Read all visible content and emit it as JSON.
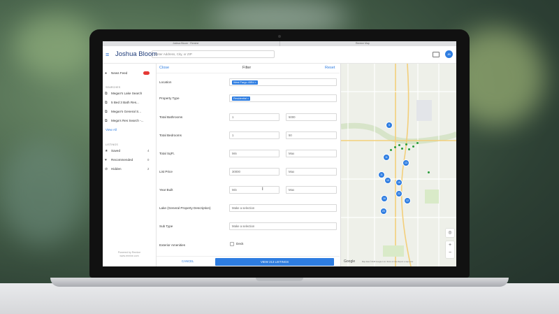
{
  "browser": {
    "tab_left": "Joshua Bloom · Remine",
    "tab_right": "Remine Map"
  },
  "header": {
    "title": "Joshua Bloom",
    "search_placeholder": "Enter Address, City, or ZIP",
    "avatar_initials": "JB"
  },
  "sidebar": {
    "news_feed": "News Feed",
    "searches_heading": "SEARCHES",
    "searches": [
      "Megan's Lake Search",
      "5 Bed 3 Bath Res...",
      "Megan's General S...",
      "Mega's Res Search -..."
    ],
    "view_all": "View All",
    "listings_heading": "LISTINGS",
    "listings": [
      {
        "label": "Saved",
        "count": "4"
      },
      {
        "label": "Recommended",
        "count": "0"
      },
      {
        "label": "Hidden",
        "count": "2"
      }
    ],
    "footer_line1": "Powered by Remine",
    "footer_line2": "www.remine.com"
  },
  "filter": {
    "close": "Close",
    "title": "Filter",
    "reset": "Reset",
    "location_label": "Location",
    "location_chip": "West Fargo 45Ed ×",
    "property_type_label": "Property Type",
    "property_type_chip": "Residential ×",
    "bathrooms_label": "Total Bathrooms",
    "bathrooms_min": "1",
    "bathrooms_max": "5000",
    "bedrooms_label": "Total Bedrooms",
    "bedrooms_min": "1",
    "bedrooms_max": "50",
    "sqft_label": "Total SqFt.",
    "sqft_min": "Min",
    "sqft_max": "Max",
    "price_label": "List Price",
    "price_min": "30000",
    "price_max": "Max",
    "year_label": "Year Built",
    "year_min": "Min",
    "year_max": "Max",
    "lake_label": "Lake (General Property Description)",
    "lake_placeholder": "Make a selection",
    "subtype_label": "Sub Type",
    "subtype_placeholder": "Make a selection",
    "amenities_label": "Exterior Amenities",
    "amenities_option": "Deck",
    "cancel": "CANCEL",
    "view_listings": "VIEW 213 LISTINGS"
  },
  "map": {
    "logo": "Google",
    "attribution": "Map data ©2018 Google  1 km  Terms of Use  Report a map error",
    "clusters": [
      "5",
      "11",
      "13",
      "11",
      "10",
      "15",
      "12",
      "22",
      "16",
      "20"
    ]
  }
}
